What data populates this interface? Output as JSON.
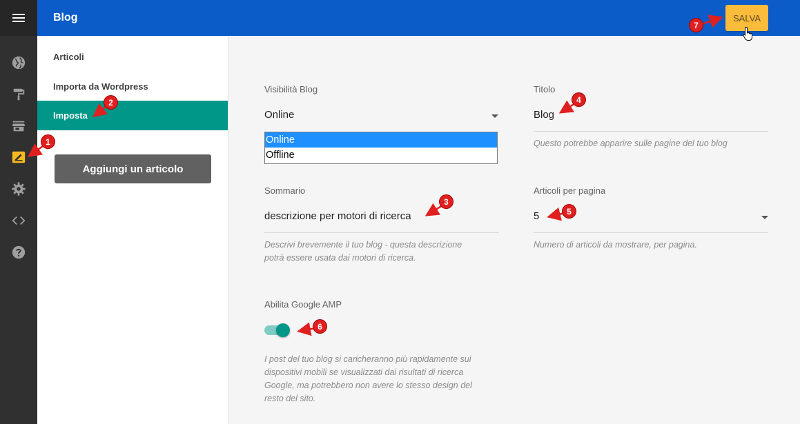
{
  "header": {
    "title": "Blog",
    "save_label": "SALVA"
  },
  "rail": {
    "items": [
      "menu-icon",
      "globe-icon",
      "paint-roller-icon",
      "store-icon",
      "blog-edit-icon",
      "gear-icon",
      "code-icon",
      "help-icon"
    ]
  },
  "sidebar": {
    "items": [
      {
        "label": "Articoli"
      },
      {
        "label": "Importa da Wordpress"
      },
      {
        "label": "Imposta"
      }
    ],
    "add_button": "Aggiungi un articolo"
  },
  "form": {
    "visibility": {
      "label": "Visibilità Blog",
      "value": "Online",
      "options": [
        "Online",
        "Offline"
      ]
    },
    "title": {
      "label": "Titolo",
      "value": "Blog",
      "hint": "Questo potrebbe apparire sulle pagine del tuo blog"
    },
    "summary": {
      "label": "Sommario",
      "value": "descrizione per motori di ricerca",
      "hint_line1": "Descrivi brevemente il tuo blog - questa descrizione",
      "hint_line2": "potrà essere usata dai motori di ricerca."
    },
    "per_page": {
      "label": "Articoli per pagina",
      "value": "5",
      "hint": "Numero di articoli da mostrare, per pagina."
    },
    "amp": {
      "label": "Abilita Google AMP",
      "enabled": true,
      "hint_line1": "I post del tuo blog si caricheranno più rapidamente sui",
      "hint_line2": "dispositivi mobili se visualizzati dai risultati di ricerca",
      "hint_line3": "Google, ma potrebbero non avere lo stesso design del",
      "hint_line4": "resto del sito."
    }
  },
  "markers": [
    "1",
    "2",
    "3",
    "4",
    "5",
    "6",
    "7"
  ],
  "colors": {
    "header": "#0b5cc9",
    "accent": "#009688",
    "save": "#fbbc3b",
    "rail": "#303030",
    "marker": "#e02020"
  }
}
